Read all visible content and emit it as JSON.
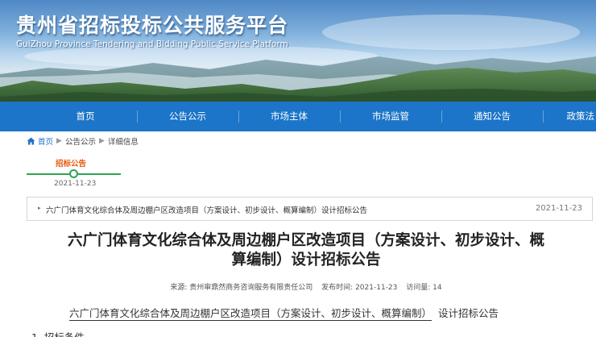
{
  "header": {
    "title": "贵州省招标投标公共服务平台",
    "subtitle": "GuiZhou Province Tendering and Bidding Public Service Platform"
  },
  "nav": {
    "items": [
      {
        "label": "首页"
      },
      {
        "label": "公告公示"
      },
      {
        "label": "市场主体"
      },
      {
        "label": "市场监管"
      },
      {
        "label": "通知公告"
      },
      {
        "label": "政策法"
      }
    ]
  },
  "breadcrumb": {
    "items": [
      "首页",
      "公告公示",
      "详细信息"
    ],
    "separator": "▶"
  },
  "timeline": {
    "label": "招标公告",
    "date": "2021-11-23"
  },
  "related": {
    "arrow": "▸",
    "link_text": "六广门体育文化综合体及周边棚户区改造项目（方案设计、初步设计、概算编制）设计招标公告",
    "date": "2021-11-23"
  },
  "article": {
    "title_line1": "六广门体育文化综合体及周边棚户区改造项目（方案设计、初步设计、概",
    "title_line2": "算编制）设计招标公告",
    "meta_source": "来源: 贵州审鼎然商务咨询服务有限责任公司",
    "meta_published": "发布时间: 2021-11-23",
    "meta_views": "访问量: 14",
    "subtitle_underlined": "六广门体育文化综合体及周边棚户区改造项目（方案设计、初步设计、概算编制）",
    "subtitle_rest": "设计招标公告",
    "section_1": "1. 招标条件"
  },
  "colors": {
    "nav_bg": "#1c75c8",
    "accent_orange": "#e8590c",
    "timeline_green": "#2ea44f"
  },
  "icons": {
    "home": "home-icon",
    "breadcrumb_separator": "chevron-right-icon",
    "notice_arrow": "triangle-right-icon"
  }
}
